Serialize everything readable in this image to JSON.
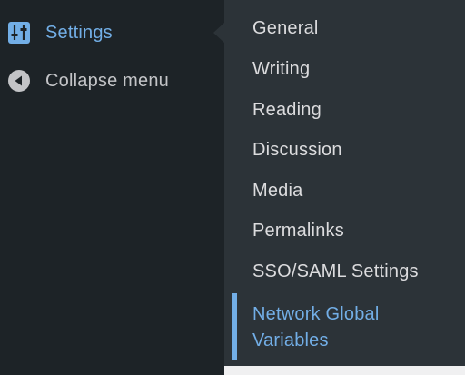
{
  "admin_menu": {
    "settings": {
      "label": "Settings",
      "icon": "settings-sliders-icon"
    },
    "collapse": {
      "label": "Collapse menu",
      "icon": "collapse-arrow-icon"
    }
  },
  "submenu": {
    "items": [
      {
        "label": "General"
      },
      {
        "label": "Writing"
      },
      {
        "label": "Reading"
      },
      {
        "label": "Discussion"
      },
      {
        "label": "Media"
      },
      {
        "label": "Permalinks"
      },
      {
        "label": "SSO/SAML Settings"
      },
      {
        "label": "Network Global Variables",
        "current": true
      }
    ]
  },
  "colors": {
    "menu_bg": "#1d2327",
    "submenu_bg": "#2c3338",
    "accent": "#72aee6",
    "text": "#dcdcde",
    "muted_text": "#c3c4c7"
  }
}
